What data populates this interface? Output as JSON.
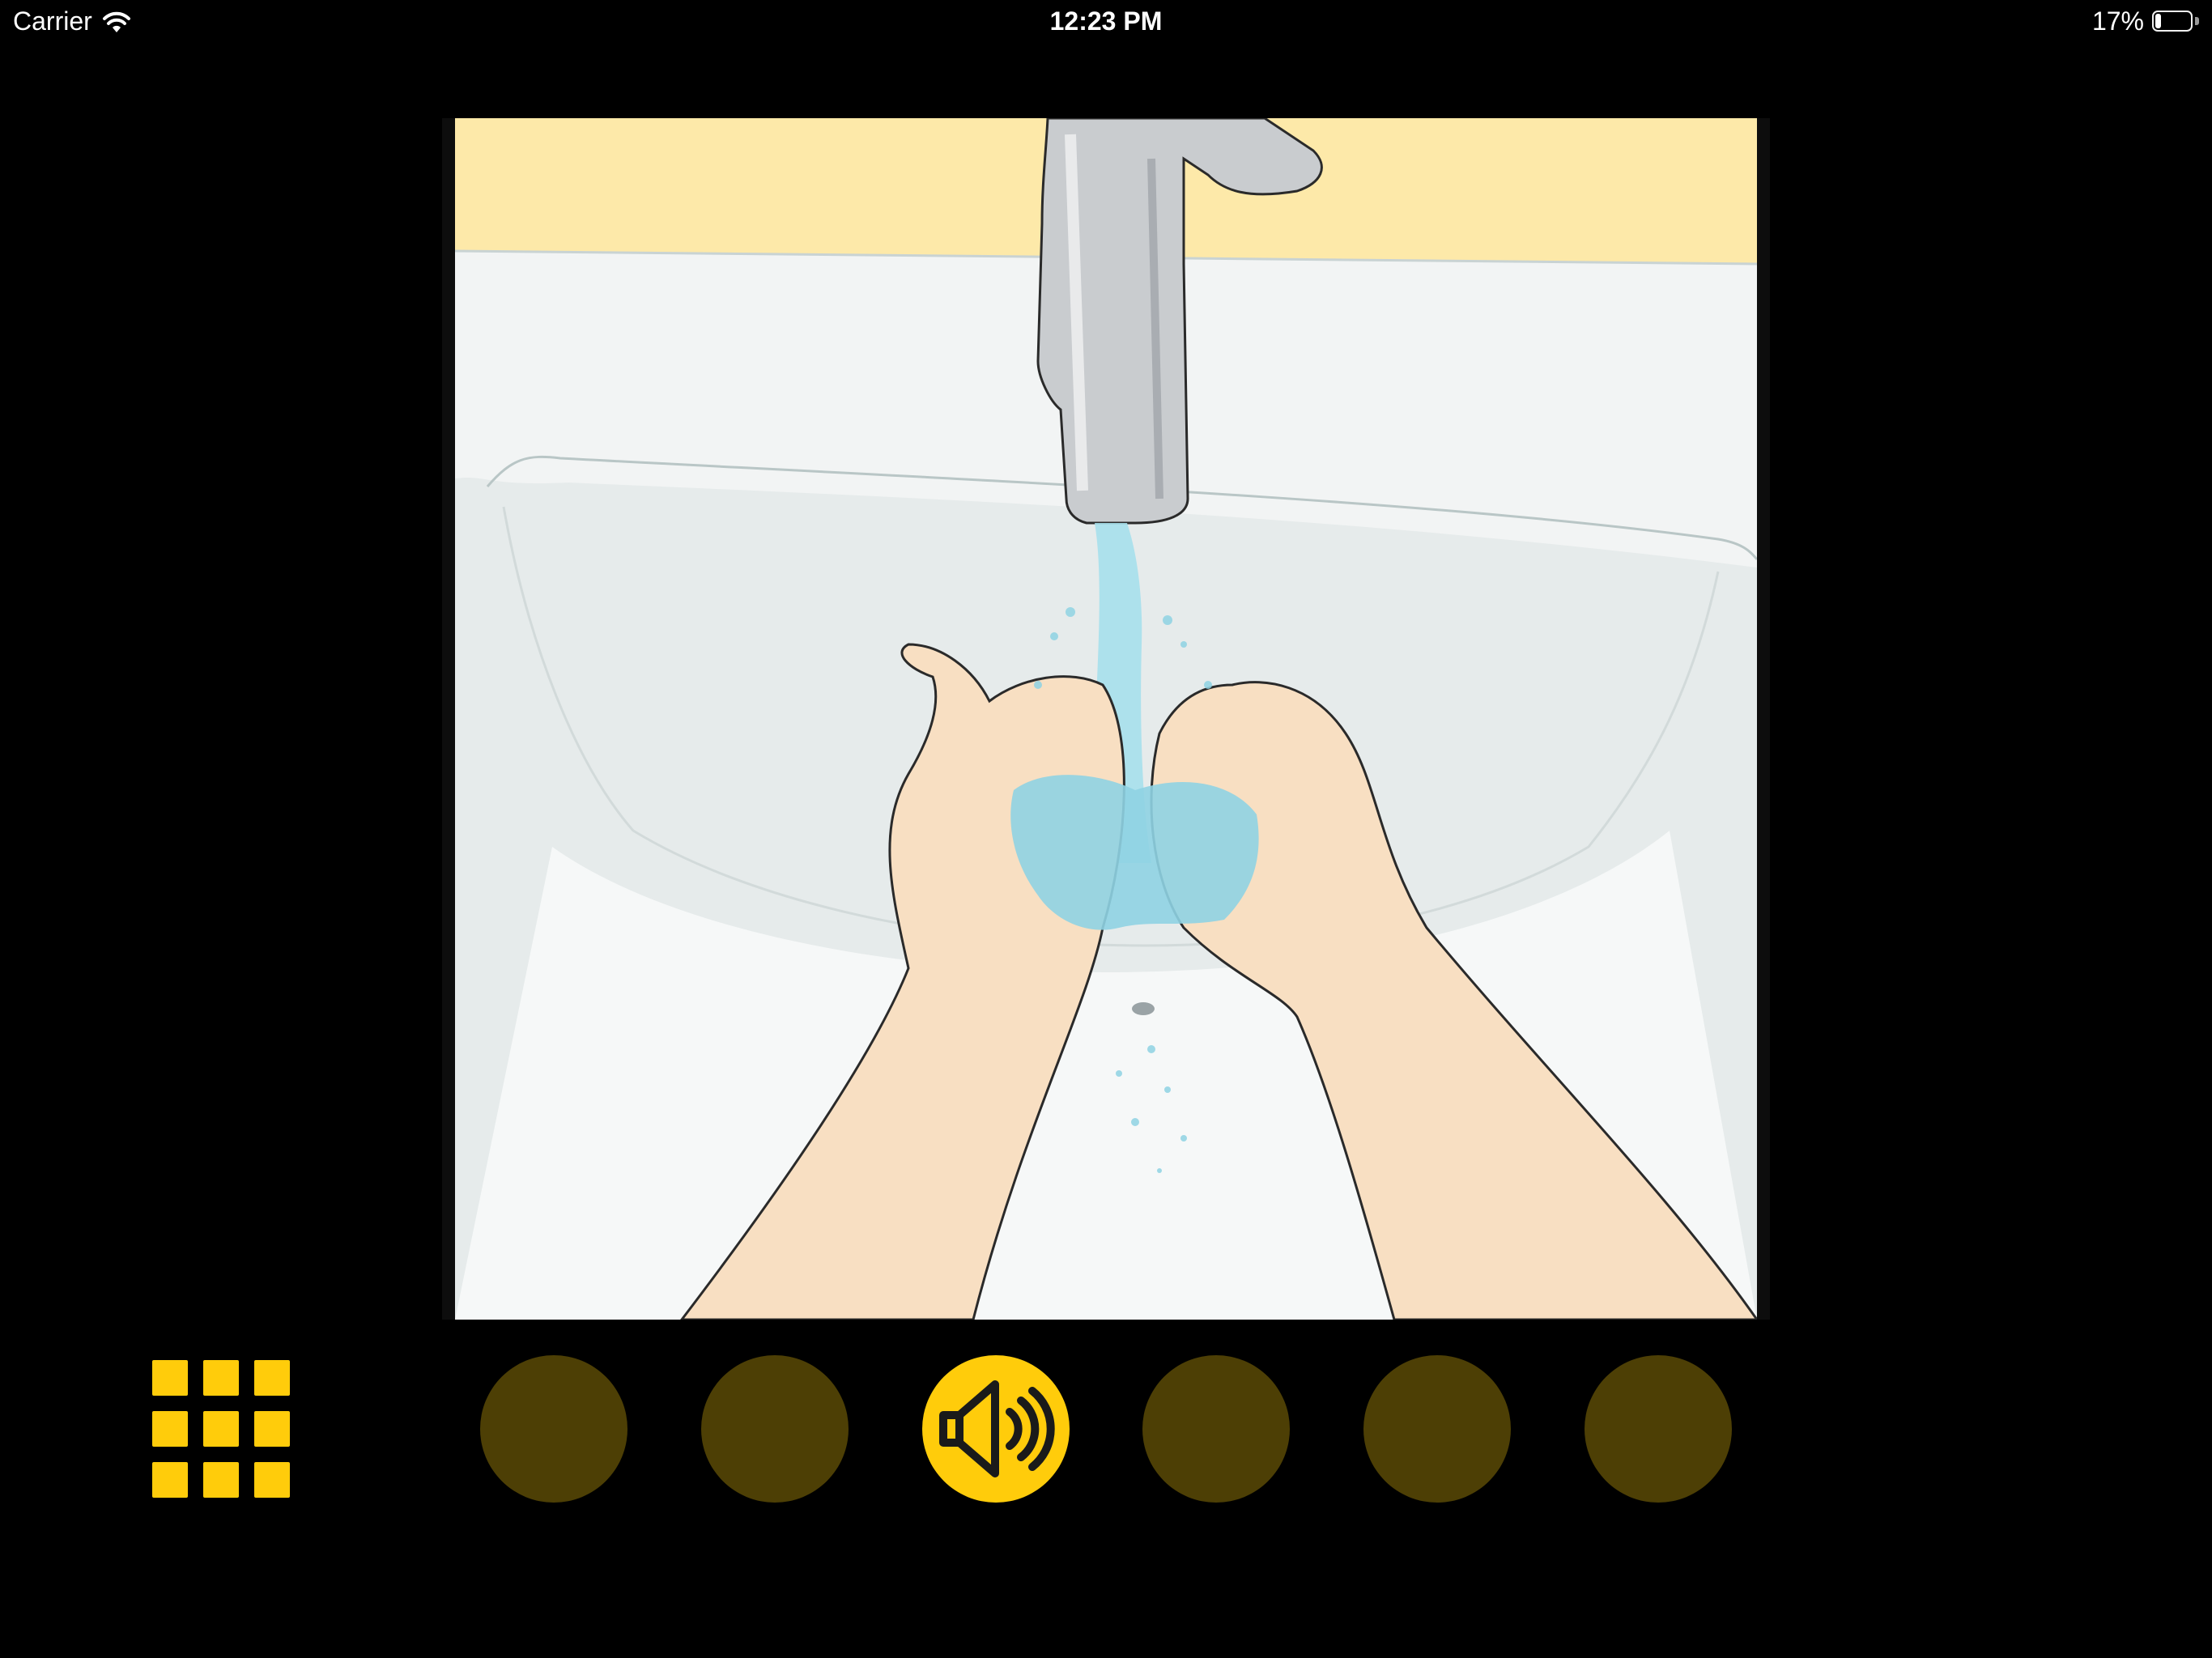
{
  "status_bar": {
    "carrier": "Carrier",
    "time": "12:23 PM",
    "battery_percent": "17%",
    "battery_level": 0.17,
    "wifi_icon": "wifi-icon",
    "battery_icon": "battery-icon"
  },
  "illustration": {
    "icon": "handwashing-illustration"
  },
  "controls": {
    "menu_icon": "grid-menu-icon",
    "speaker_icon": "speaker-icon",
    "steps_total": 6,
    "active_step": 3
  },
  "colors": {
    "accent": "#ffcc0b",
    "inactive_dot": "#4d3f05",
    "background": "#000000",
    "wall": "#fde9a9",
    "sink": "#f1f3f3",
    "skin": "#f8dfc2",
    "water": "#8fd3e3"
  }
}
